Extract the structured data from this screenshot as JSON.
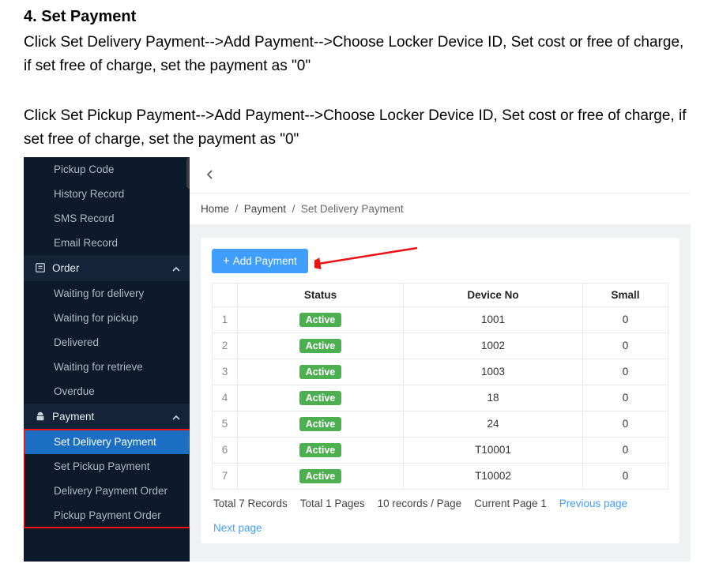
{
  "doc": {
    "heading": "4.   Set Payment",
    "para1": "Click Set Delivery Payment-->Add Payment-->Choose Locker Device ID, Set cost or free of charge, if set free of charge, set the payment as \"0\"",
    "para2": "Click Set Pickup Payment-->Add Payment-->Choose Locker Device ID, Set cost or free of charge, if set free of charge, set the payment as \"0\""
  },
  "sidebar": {
    "top_items": [
      "Pickup Code",
      "History Record",
      "SMS Record",
      "Email Record"
    ],
    "order_group": "Order",
    "order_items": [
      "Waiting for delivery",
      "Waiting for pickup",
      "Delivered",
      "Waiting for retrieve",
      "Overdue"
    ],
    "payment_group": "Payment",
    "payment_items": [
      "Set Delivery Payment",
      "Set Pickup Payment",
      "Delivery Payment Order",
      "Pickup Payment Order"
    ]
  },
  "breadcrumb": {
    "home": "Home",
    "group": "Payment",
    "page": "Set Delivery Payment"
  },
  "buttons": {
    "add_payment": "Add Payment"
  },
  "table": {
    "headers": {
      "status": "Status",
      "device": "Device No",
      "small": "Small"
    },
    "badge_label": "Active",
    "rows": [
      {
        "idx": "1",
        "device": "1001",
        "small": "0"
      },
      {
        "idx": "2",
        "device": "1002",
        "small": "0"
      },
      {
        "idx": "3",
        "device": "1003",
        "small": "0"
      },
      {
        "idx": "4",
        "device": "18",
        "small": "0"
      },
      {
        "idx": "5",
        "device": "24",
        "small": "0"
      },
      {
        "idx": "6",
        "device": "T10001",
        "small": "0"
      },
      {
        "idx": "7",
        "device": "T10002",
        "small": "0"
      }
    ]
  },
  "pager": {
    "total_records": "Total 7 Records",
    "total_pages": "Total 1 Pages",
    "per_page": "10 records / Page",
    "current": "Current Page 1",
    "prev": "Previous page",
    "next": "Next page"
  }
}
